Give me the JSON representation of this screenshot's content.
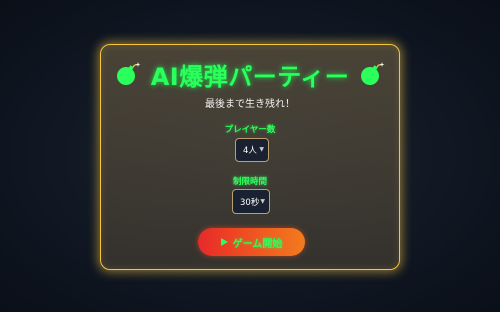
{
  "header": {
    "title": "AI爆弾パーティー",
    "subtitle": "最後まで生き残れ！"
  },
  "settings": {
    "players_label": "プレイヤー数",
    "players_value": "4人",
    "time_label": "制限時間",
    "time_value": "30秒"
  },
  "actions": {
    "start_label": "ゲーム開始"
  },
  "icons": {
    "title_left": "bomb-icon",
    "title_right": "bomb-icon",
    "players_select": "chevron-down-icon",
    "time_select": "chevron-down-icon",
    "start": "play-icon"
  },
  "colors": {
    "accent_green": "#2bff5c",
    "panel_border": "#f5c542",
    "button_start": "#e62a2a",
    "button_end": "#f27b1e"
  }
}
